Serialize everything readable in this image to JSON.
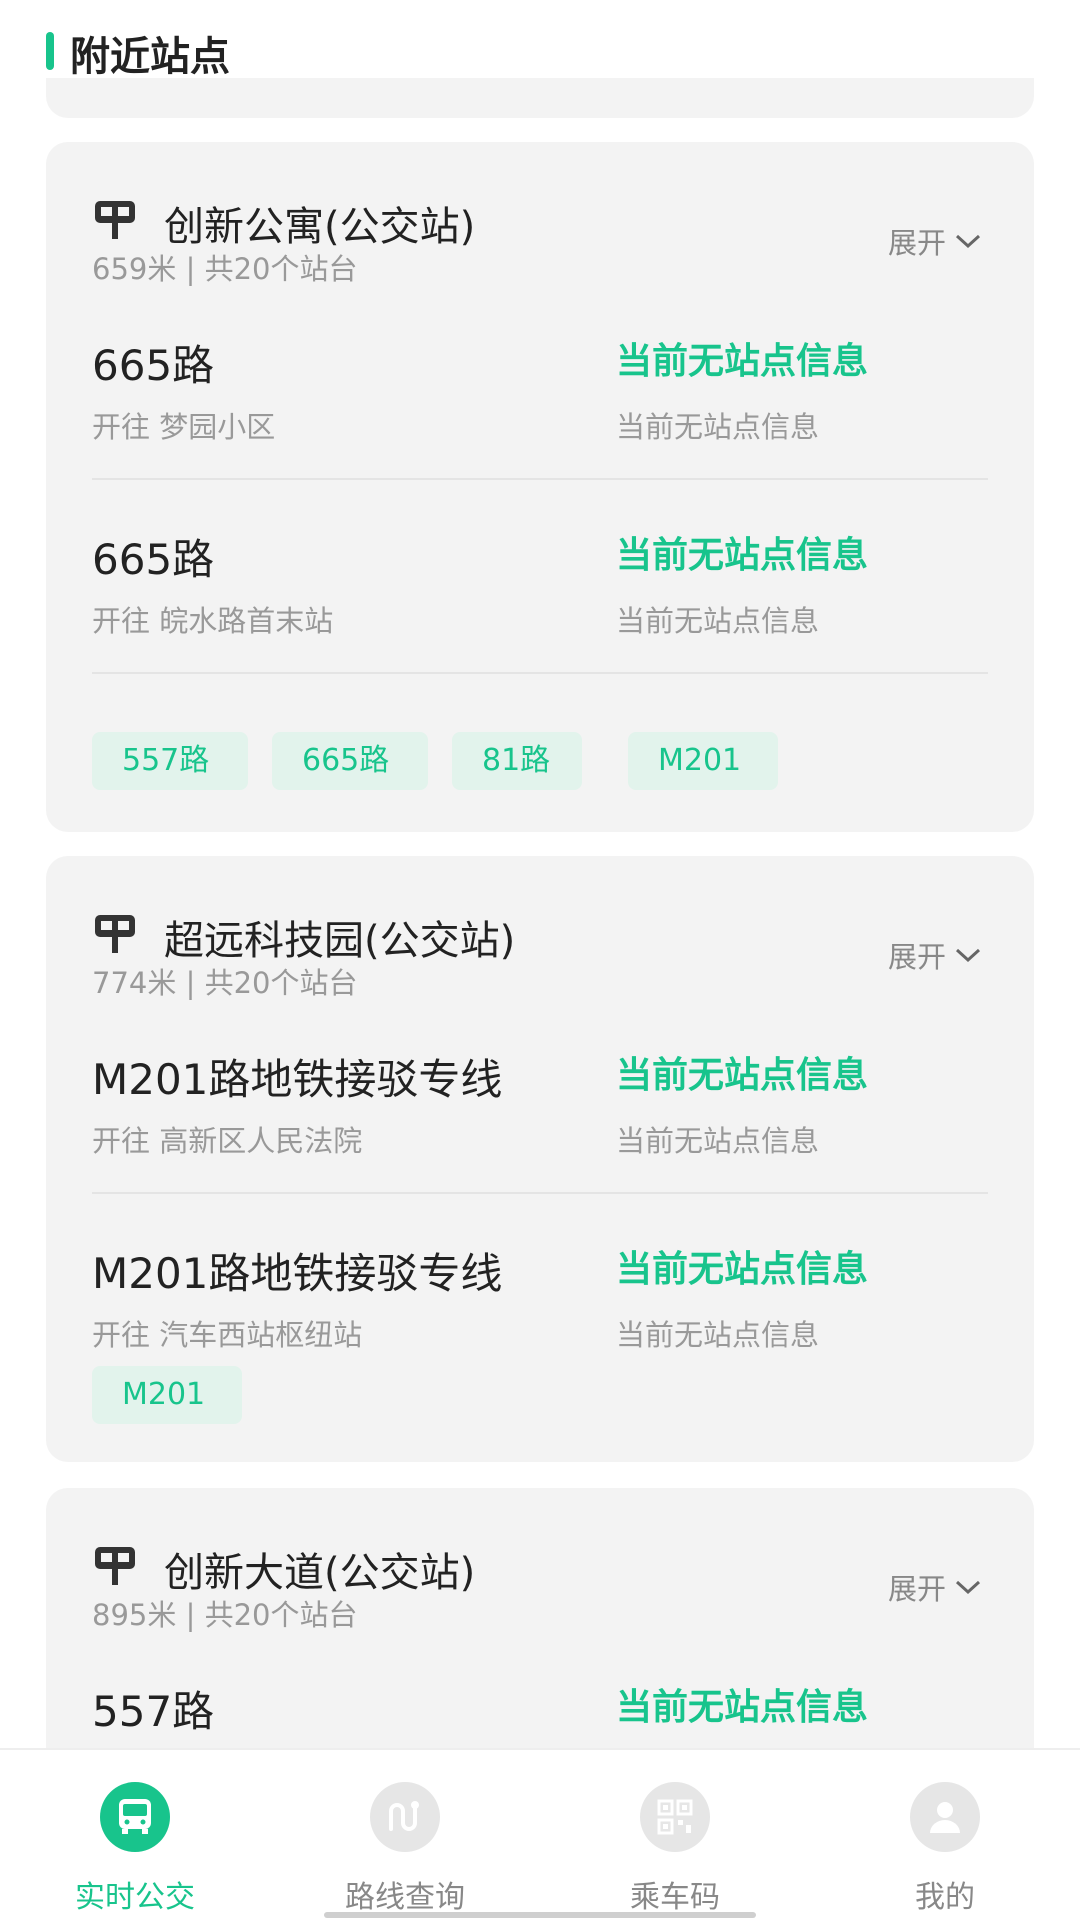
{
  "header": {
    "title": "附近站点"
  },
  "stations": [
    {
      "name": "创新公寓(公交站)",
      "distance": "659米",
      "platforms": "共20个站台",
      "expand_label": "展开",
      "routes": [
        {
          "name": "665路",
          "direction_prefix": "开往",
          "destination": "梦园小区",
          "status": "当前无站点信息",
          "status_detail": "当前无站点信息"
        },
        {
          "name": "665路",
          "direction_prefix": "开往",
          "destination": "皖水路首末站",
          "status": "当前无站点信息",
          "status_detail": "当前无站点信息"
        }
      ],
      "chips": [
        "557路",
        "665路",
        "81路",
        "M201"
      ]
    },
    {
      "name": "超远科技园(公交站)",
      "distance": "774米",
      "platforms": "共20个站台",
      "expand_label": "展开",
      "routes": [
        {
          "name": "M201路地铁接驳专线",
          "direction_prefix": "开往",
          "destination": "高新区人民法院",
          "status": "当前无站点信息",
          "status_detail": "当前无站点信息"
        },
        {
          "name": "M201路地铁接驳专线",
          "direction_prefix": "开往",
          "destination": "汽车西站枢纽站",
          "status": "当前无站点信息",
          "status_detail": "当前无站点信息"
        }
      ],
      "chips": [
        "M201"
      ]
    },
    {
      "name": "创新大道(公交站)",
      "distance": "895米",
      "platforms": "共20个站台",
      "expand_label": "展开",
      "routes": [
        {
          "name": "557路",
          "status": "当前无站点信息"
        }
      ]
    }
  ],
  "separator": "|",
  "tabs": [
    {
      "label": "实时公交",
      "icon": "bus-icon",
      "active": true
    },
    {
      "label": "路线查询",
      "icon": "route-icon",
      "active": false
    },
    {
      "label": "乘车码",
      "icon": "qr-code-icon",
      "active": false
    },
    {
      "label": "我的",
      "icon": "user-icon",
      "active": false
    }
  ],
  "colors": {
    "accent": "#18c48c",
    "card_bg": "#f3f3f3",
    "chip_bg": "#e2f3ec",
    "muted": "#999999"
  }
}
